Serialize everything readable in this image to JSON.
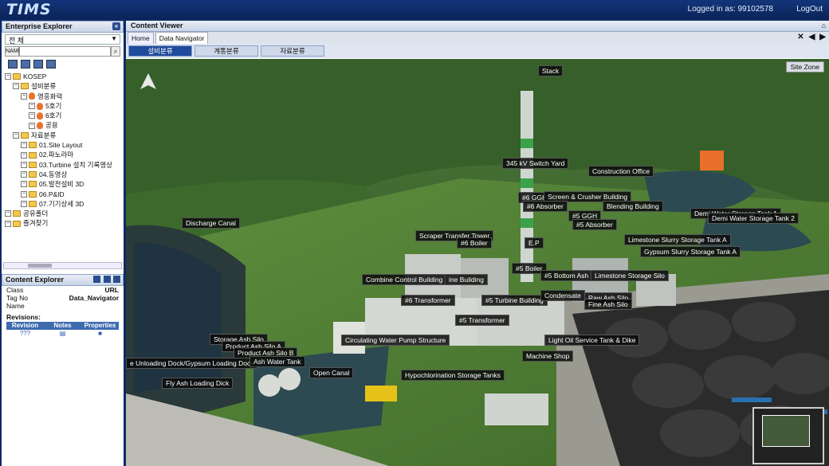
{
  "app": {
    "logo": "TIMS",
    "logged_in": "Logged in as: 99102578",
    "logout": "LogOut"
  },
  "enterprise_explorer": {
    "title": "Enterprise Explorer",
    "select": "전 체",
    "name_label": "NAME",
    "tree": [
      {
        "label": "KOSEP",
        "indent": 0,
        "type": "root"
      },
      {
        "label": "설비분류",
        "indent": 1,
        "type": "folder"
      },
      {
        "label": "영흥화력",
        "indent": 2,
        "type": "plant"
      },
      {
        "label": "5호기",
        "indent": 3,
        "type": "flame"
      },
      {
        "label": "6호기",
        "indent": 3,
        "type": "flame"
      },
      {
        "label": "공용",
        "indent": 3,
        "type": "flame"
      },
      {
        "label": "자료분류",
        "indent": 1,
        "type": "folder"
      },
      {
        "label": "01.Site Layout",
        "indent": 2,
        "type": "folder"
      },
      {
        "label": "02.파노라마",
        "indent": 2,
        "type": "folder"
      },
      {
        "label": "03.Turbine 설치 기록영상",
        "indent": 2,
        "type": "folder"
      },
      {
        "label": "04.동영상",
        "indent": 2,
        "type": "folder"
      },
      {
        "label": "05.발전설비 3D",
        "indent": 2,
        "type": "folder"
      },
      {
        "label": "06.P&ID",
        "indent": 2,
        "type": "folder"
      },
      {
        "label": "07.기기상세 3D",
        "indent": 2,
        "type": "folder"
      },
      {
        "label": "공유폴더",
        "indent": 0,
        "type": "folder"
      },
      {
        "label": "즐겨찾기",
        "indent": 0,
        "type": "folder"
      }
    ]
  },
  "content_explorer": {
    "title": "Content Explorer",
    "fields": [
      {
        "k": "Class",
        "v": "URL"
      },
      {
        "k": "Tag No",
        "v": "Data_Navigator"
      },
      {
        "k": "Name",
        "v": ""
      }
    ],
    "revisions_label": "Revisions:",
    "columns": [
      "Revision",
      "Notes",
      "Properties"
    ],
    "row": {
      "revision": "???"
    }
  },
  "content_viewer": {
    "title": "Content Viewer",
    "tabs": [
      "Home",
      "Data Navigator"
    ],
    "segments": [
      "설비분류",
      "계통분류",
      "자료분류"
    ],
    "site_zone": "Site Zone",
    "labels": [
      "Stack",
      "345 kV Switch Yard",
      "Construction Office",
      "#6 GGH",
      "Screen & Crusher Building",
      "#6 Absorber",
      "Blending Building",
      "Demi Water Storage Tank 1",
      "Demi Water Storage Tank 2",
      "#5 GGH",
      "#5 Absorber",
      "Discharge Canal",
      "Scraper Transfer Tower",
      "#6 Boiler",
      "E.P",
      "Limestone Slurry Storage Tank A",
      "Gypsum Slurry Storage Tank A",
      "#5 Boiler",
      "Combine Control Building",
      "ine Building",
      "#5 Bottom Ash",
      "Limestone Storage Silo",
      "#6 Transformer",
      "#5 Turbine Building",
      "Condensate",
      "Raw Ash Silo",
      "Fine Ash Silo",
      "#5 Transformer",
      "Storage Ash Silo",
      "Product Ash Silo A",
      "Product Ash Silo B",
      "Circulating Water Pump Structure",
      "Light Oil Service Tank & Dike",
      "Machine Shop",
      "e Unloading Dock/Gypsum Loading Dock",
      "Ash Water Tank",
      "Open Canal",
      "Hypochlorination Storage Tanks",
      "Fly Ash Loading Dick"
    ]
  }
}
